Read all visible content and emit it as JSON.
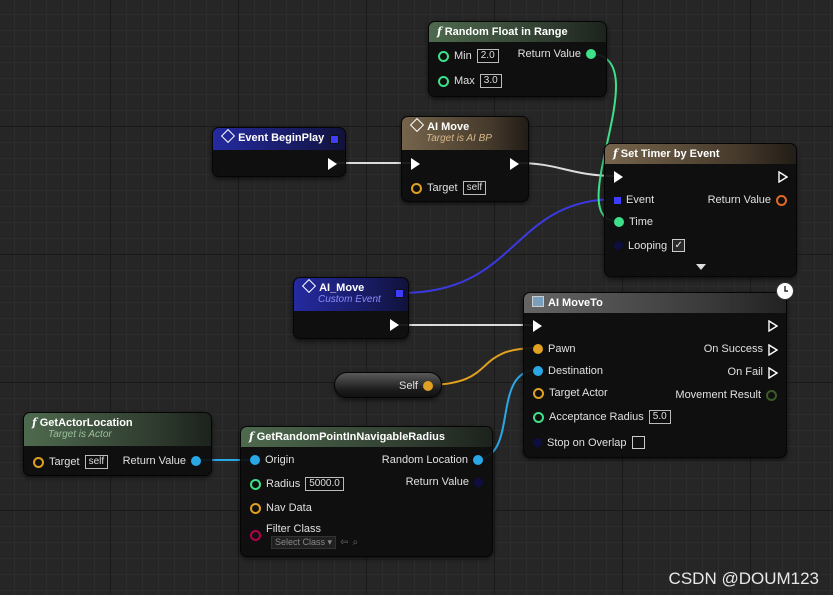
{
  "nodes": {
    "random_float": {
      "title": "Random Float in Range",
      "min_label": "Min",
      "min_value": "2.0",
      "max_label": "Max",
      "max_value": "3.0",
      "return_label": "Return Value"
    },
    "begin_play": {
      "title": "Event BeginPlay"
    },
    "ai_move_call": {
      "title": "AI Move",
      "subtitle": "Target is AI BP",
      "target_label": "Target",
      "target_value": "self"
    },
    "set_timer": {
      "title": "Set Timer by Event",
      "event_label": "Event",
      "return_label": "Return Value",
      "time_label": "Time",
      "looping_label": "Looping",
      "looping_checked": true
    },
    "ai_move_event": {
      "title": "AI_Move",
      "subtitle": "Custom Event"
    },
    "ai_moveto": {
      "title": "AI MoveTo",
      "pawn_label": "Pawn",
      "on_success_label": "On Success",
      "destination_label": "Destination",
      "on_fail_label": "On Fail",
      "target_actor_label": "Target Actor",
      "movement_result_label": "Movement Result",
      "acceptance_label": "Acceptance Radius",
      "acceptance_value": "5.0",
      "stop_label": "Stop on Overlap"
    },
    "self_node": {
      "label": "Self"
    },
    "get_actor_location": {
      "title": "GetActorLocation",
      "subtitle": "Target is Actor",
      "target_label": "Target",
      "target_value": "self",
      "return_label": "Return Value"
    },
    "random_point": {
      "title": "GetRandomPointInNavigableRadius",
      "origin_label": "Origin",
      "random_location_label": "Random Location",
      "radius_label": "Radius",
      "radius_value": "5000.0",
      "return_label": "Return Value",
      "nav_data_label": "Nav Data",
      "filter_label": "Filter Class",
      "select_class": "Select Class"
    }
  },
  "watermark": "CSDN @DOUM123",
  "colors": {
    "exec": "#ffffff",
    "float": "#3ee08a",
    "vector": "#f0c23a",
    "object": "#33a9e8",
    "delegate": "#3d3dff",
    "boolean": "#8c0000",
    "class": "#b4004d",
    "struct": "#1a1a8a"
  }
}
